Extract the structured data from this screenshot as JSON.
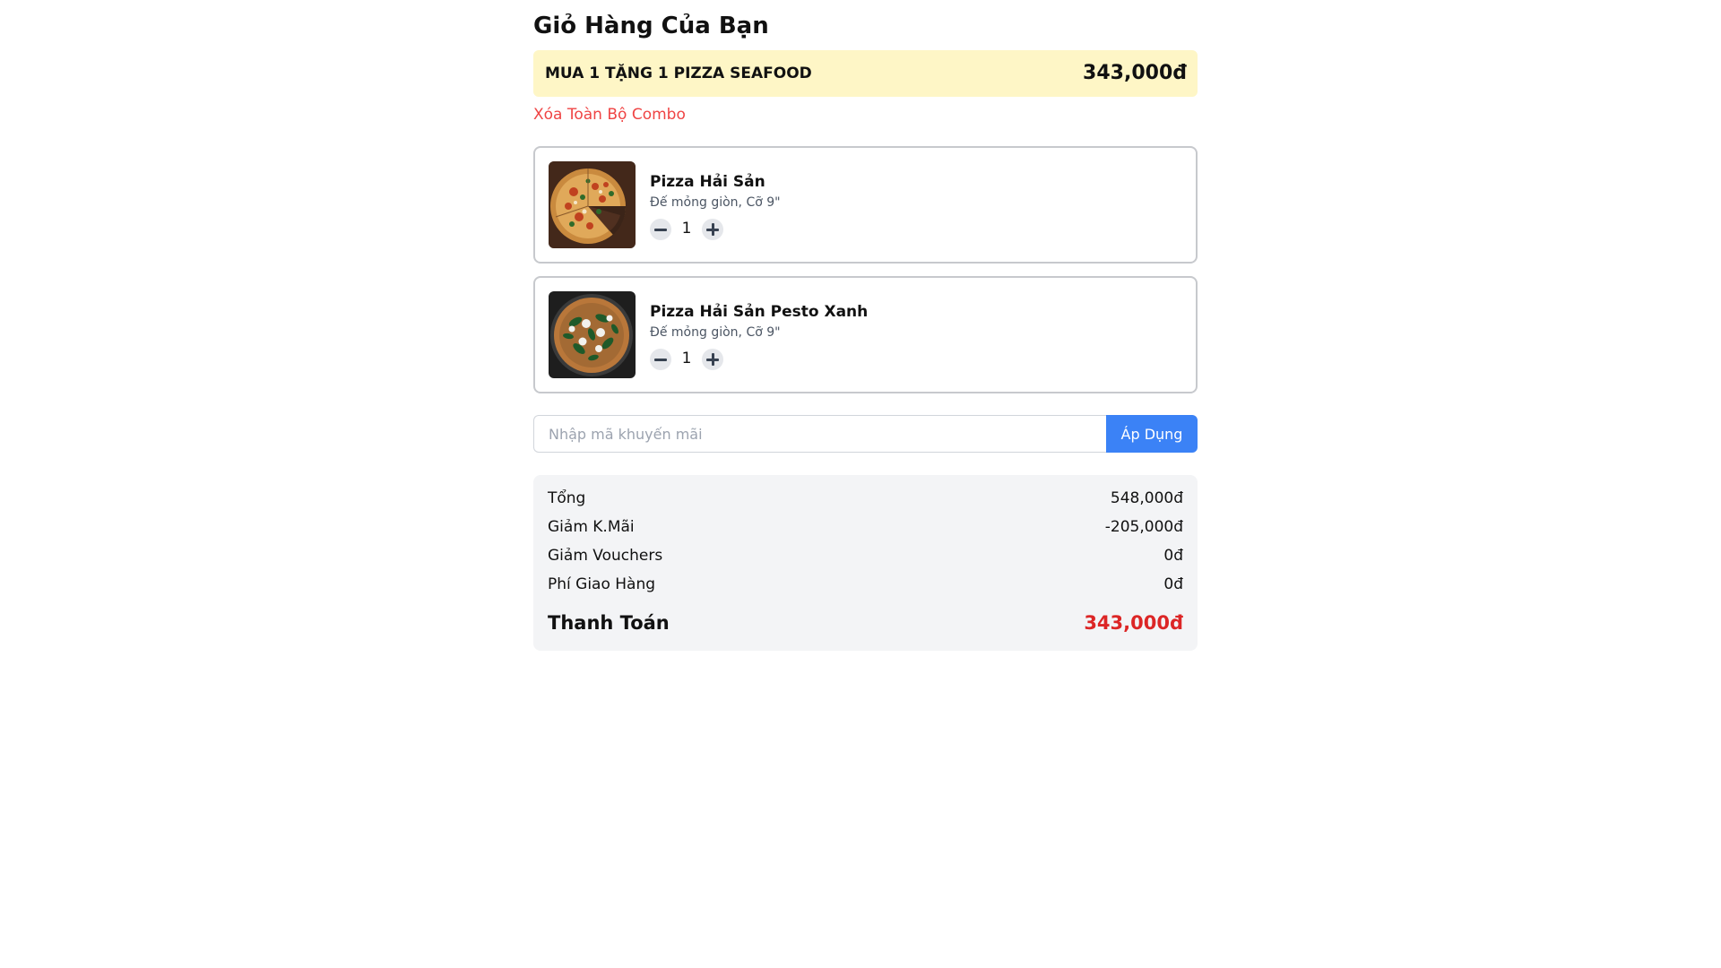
{
  "cart": {
    "title": "Giỏ Hàng Của Bạn"
  },
  "combo": {
    "name": "MUA 1 TẶNG 1 PIZZA SEAFOOD",
    "price": "343,000đ",
    "clear_label": "Xóa Toàn Bộ Combo",
    "bg_color": "#fef6c6"
  },
  "items": [
    {
      "name": "Pizza Hải Sản",
      "desc": "Đế mỏng giòn, Cỡ 9\"",
      "qty": "1",
      "image_icon": "pizza-seafood-photo"
    },
    {
      "name": "Pizza Hải Sản Pesto Xanh",
      "desc": "Đế mỏng giòn, Cỡ 9\"",
      "qty": "1",
      "image_icon": "pizza-pesto-photo"
    }
  ],
  "promo": {
    "placeholder": "Nhập mã khuyến mãi",
    "value": "",
    "apply_label": "Áp Dụng",
    "apply_color": "#3b82f6"
  },
  "summary": {
    "subtotal_label": "Tổng",
    "subtotal_value": "548,000đ",
    "promo_discount_label": "Giảm K.Mãi",
    "promo_discount_value": "-205,000đ",
    "voucher_discount_label": "Giảm Vouchers",
    "voucher_discount_value": "0đ",
    "shipping_label": "Phí Giao Hàng",
    "shipping_value": "0đ",
    "total_label": "Thanh Toán",
    "total_value": "343,000đ",
    "total_color": "#dc2626"
  }
}
